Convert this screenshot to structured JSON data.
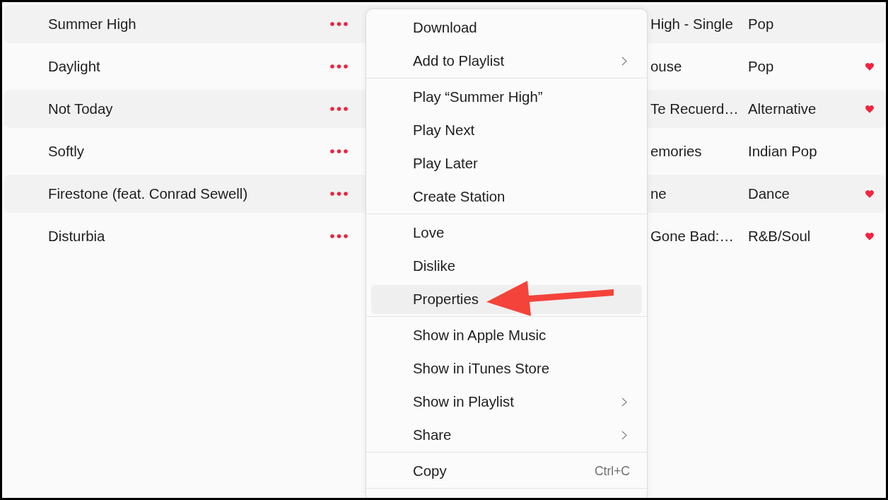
{
  "songs": [
    {
      "title": "Summer High",
      "album": "High - Single",
      "genre": "Pop",
      "loved": false
    },
    {
      "title": "Daylight",
      "album": "ouse",
      "genre": "Pop",
      "loved": true
    },
    {
      "title": "Not Today",
      "album": "Te Recuerd…",
      "genre": "Alternative",
      "loved": true
    },
    {
      "title": "Softly",
      "album": "emories",
      "genre": "Indian Pop",
      "loved": false
    },
    {
      "title": "Firestone (feat. Conrad Sewell)",
      "album": "ne",
      "genre": "Dance",
      "loved": true
    },
    {
      "title": "Disturbia",
      "album": "Gone Bad:…",
      "genre": "R&B/Soul",
      "loved": true
    }
  ],
  "context_menu": {
    "groups": [
      {
        "items": [
          {
            "label": "Download",
            "submenu": false,
            "selected": false
          },
          {
            "label": "Add to Playlist",
            "submenu": true,
            "selected": false
          }
        ]
      },
      {
        "items": [
          {
            "label": "Play “Summer High”",
            "submenu": false,
            "selected": false
          },
          {
            "label": "Play Next",
            "submenu": false,
            "selected": false
          },
          {
            "label": "Play Later",
            "submenu": false,
            "selected": false
          },
          {
            "label": "Create Station",
            "submenu": false,
            "selected": false
          }
        ]
      },
      {
        "items": [
          {
            "label": "Love",
            "submenu": false,
            "selected": false
          },
          {
            "label": "Dislike",
            "submenu": false,
            "selected": false
          },
          {
            "label": "Properties",
            "submenu": false,
            "selected": true
          }
        ]
      },
      {
        "items": [
          {
            "label": "Show in Apple Music",
            "submenu": false,
            "selected": false
          },
          {
            "label": "Show in iTunes Store",
            "submenu": false,
            "selected": false
          },
          {
            "label": "Show in Playlist",
            "submenu": true,
            "selected": false
          },
          {
            "label": "Share",
            "submenu": true,
            "selected": false
          }
        ]
      },
      {
        "items": [
          {
            "label": "Copy",
            "submenu": false,
            "selected": false,
            "shortcut": "Ctrl+C"
          }
        ]
      }
    ]
  }
}
